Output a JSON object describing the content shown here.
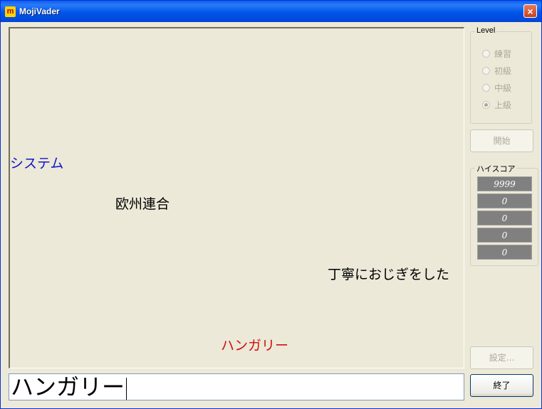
{
  "window": {
    "title": "MojiVader",
    "logo": "m",
    "close_glyph": "×"
  },
  "play_area": {
    "words": [
      {
        "id": "w1",
        "text": "システム",
        "color": "#1515C8"
      },
      {
        "id": "w2",
        "text": "欧州連合",
        "color": "#000000"
      },
      {
        "id": "w3",
        "text": "丁寧におじぎをした",
        "color": "#000000"
      },
      {
        "id": "w4",
        "text": "ハンガリー",
        "color": "#D01010"
      }
    ]
  },
  "input": {
    "value": "ハンガリー"
  },
  "level": {
    "legend": "Level",
    "options": [
      {
        "label": "練習",
        "checked": false
      },
      {
        "label": "初級",
        "checked": false
      },
      {
        "label": "中級",
        "checked": false
      },
      {
        "label": "上級",
        "checked": true
      }
    ]
  },
  "buttons": {
    "start": "開始",
    "settings": "設定...",
    "quit": "終了"
  },
  "highscore": {
    "legend": "ハイスコア",
    "scores": [
      "9999",
      "0",
      "0",
      "0",
      "0"
    ]
  }
}
